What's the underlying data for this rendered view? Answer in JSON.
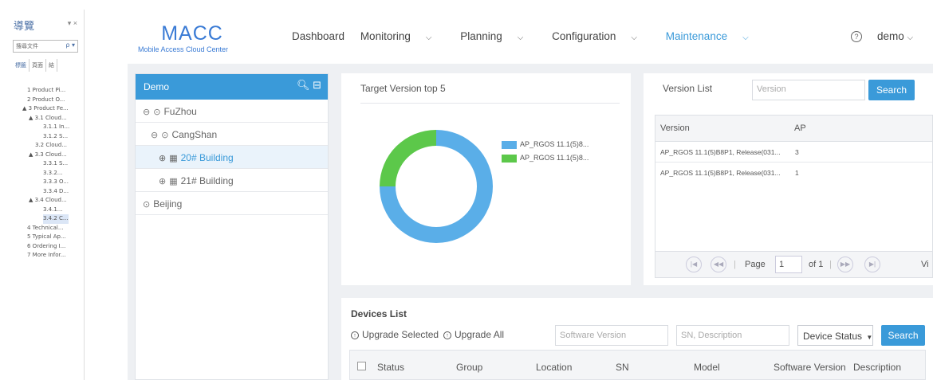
{
  "nav_pane": {
    "title": "導覽",
    "controls": "▾ ×",
    "search_placeholder": "搜尋文件",
    "search_icon": "ρ ▾",
    "tabs": [
      "標籤",
      "頁面",
      "結"
    ],
    "tree": [
      "1 Product Pi...",
      "2 Product O...",
      "▲ 3 Product Fe...",
      "▲ 3.1 Cloud...",
      "3.1.1 In...",
      "3.1.2 S...",
      "3.2 Cloud...",
      "▲ 3.3 Cloud...",
      "3.3.1 S...",
      "3.3.2...",
      "3.3.3 O...",
      "3.3.4 D...",
      "▲ 3.4 Cloud...",
      "3.4.1...",
      "3.4.2 C...",
      "4 Technical...",
      "5 Typical Ap...",
      "6 Ordering I...",
      "7 More Infor..."
    ]
  },
  "header": {
    "logo": "MACC",
    "logo_sub": "Mobile Access Cloud Center",
    "nav": {
      "dashboard": "Dashboard",
      "monitoring": "Monitoring",
      "planning": "Planning",
      "configuration": "Configuration",
      "maintenance": "Maintenance"
    },
    "help_icon": "?",
    "user": "demo"
  },
  "tree_panel": {
    "title": "Demo",
    "nodes": {
      "fuzhou": "FuZhou",
      "cangshan": "CangShan",
      "b20": "20# Building",
      "b21": "21# Building",
      "beijing": "Beijing"
    }
  },
  "chart_panel": {
    "title": "Target Version top 5"
  },
  "chart_data": {
    "type": "pie",
    "donut": true,
    "title": "Target Version top 5",
    "series": [
      {
        "name": "AP_RGOS 11.1(5)8...",
        "value": 3,
        "color": "#5aaee8"
      },
      {
        "name": "AP_RGOS 11.1(5)8...",
        "value": 1,
        "color": "#5cc84a"
      }
    ],
    "legend_position": "right"
  },
  "version_panel": {
    "title": "Version List",
    "search_placeholder": "Version",
    "search_button": "Search",
    "columns": [
      "Version",
      "AP"
    ],
    "rows": [
      {
        "version": "AP_RGOS 11.1(5)B8P1, Release(031...",
        "ap": "3"
      },
      {
        "version": "AP_RGOS 11.1(5)B8P1, Release(031...",
        "ap": "1"
      }
    ],
    "pager": {
      "first": "|◀",
      "prev": "◀◀",
      "page_label": "Page",
      "page_value": "1",
      "of_label": "of 1",
      "next": "▶▶",
      "last": "▶|",
      "view": "Vi"
    }
  },
  "devices_panel": {
    "title": "Devices List",
    "upgrade_selected": "Upgrade Selected",
    "upgrade_all": "Upgrade All",
    "software_placeholder": "Software Version",
    "sn_placeholder": "SN, Description",
    "status_select": "Device Status",
    "search_button": "Search",
    "columns": [
      "Status",
      "Group",
      "Location",
      "SN",
      "Model",
      "Software Version",
      "Description"
    ]
  }
}
